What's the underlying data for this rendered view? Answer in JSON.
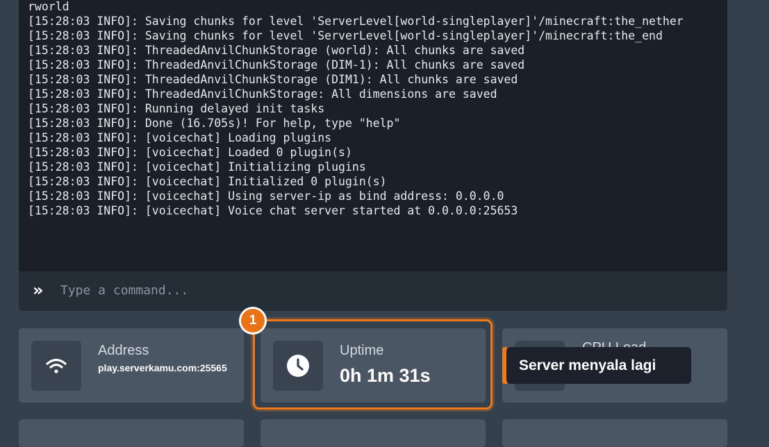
{
  "console": {
    "log_lines": [
      "rworld",
      "[15:28:03 INFO]: Saving chunks for level 'ServerLevel[world-singleplayer]'/minecraft:the_nether",
      "[15:28:03 INFO]: Saving chunks for level 'ServerLevel[world-singleplayer]'/minecraft:the_end",
      "[15:28:03 INFO]: ThreadedAnvilChunkStorage (world): All chunks are saved",
      "[15:28:03 INFO]: ThreadedAnvilChunkStorage (DIM-1): All chunks are saved",
      "[15:28:03 INFO]: ThreadedAnvilChunkStorage (DIM1): All chunks are saved",
      "[15:28:03 INFO]: ThreadedAnvilChunkStorage: All dimensions are saved",
      "[15:28:03 INFO]: Running delayed init tasks",
      "[15:28:03 INFO]: Done (16.705s)! For help, type \"help\"",
      "[15:28:03 INFO]: [voicechat] Loading plugins",
      "[15:28:03 INFO]: [voicechat] Loaded 0 plugin(s)",
      "[15:28:03 INFO]: [voicechat] Initializing plugins",
      "[15:28:03 INFO]: [voicechat] Initialized 0 plugin(s)",
      "[15:28:03 INFO]: [voicechat] Using server-ip as bind address: 0.0.0.0",
      "[15:28:03 INFO]: [voicechat] Voice chat server started at 0.0.0.0:25653"
    ],
    "command_icon": "chevrons-right-icon",
    "command_placeholder": "Type a command..."
  },
  "cards": {
    "address": {
      "icon": "wifi-icon",
      "label": "Address",
      "value": "play.serverkamu.com:25565"
    },
    "uptime": {
      "icon": "clock-icon",
      "label": "Uptime",
      "value": "0h 1m 31s"
    },
    "cpu": {
      "label_partial": "CPU Load"
    }
  },
  "tutorial": {
    "step_number": "1",
    "tooltip_text": "Server menyala lagi",
    "accent_color": "#f07a1a"
  }
}
